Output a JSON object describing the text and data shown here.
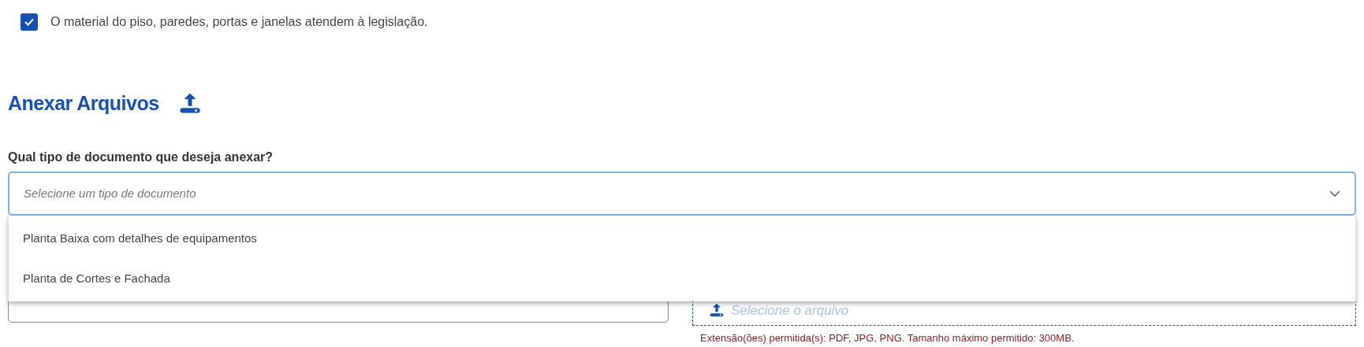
{
  "checkbox": {
    "label": "O material do piso, paredes, portas e janelas atendem à legislação.",
    "checked": true
  },
  "section": {
    "title": "Anexar Arquivos"
  },
  "document_type": {
    "label": "Qual tipo de documento que deseja anexar?",
    "placeholder": "Selecione um tipo de documento",
    "expanded": true,
    "options": [
      {
        "label": "Planta Baixa com detalhes de equipamentos"
      },
      {
        "label": "Planta de Cortes e Fachada"
      }
    ]
  },
  "file_upload": {
    "placeholder": "Selecione o arquivo",
    "hint": "Extensão(ões) permitida(s): PDF, JPG, PNG. Tamanho máximo permitido: 300MB."
  }
}
